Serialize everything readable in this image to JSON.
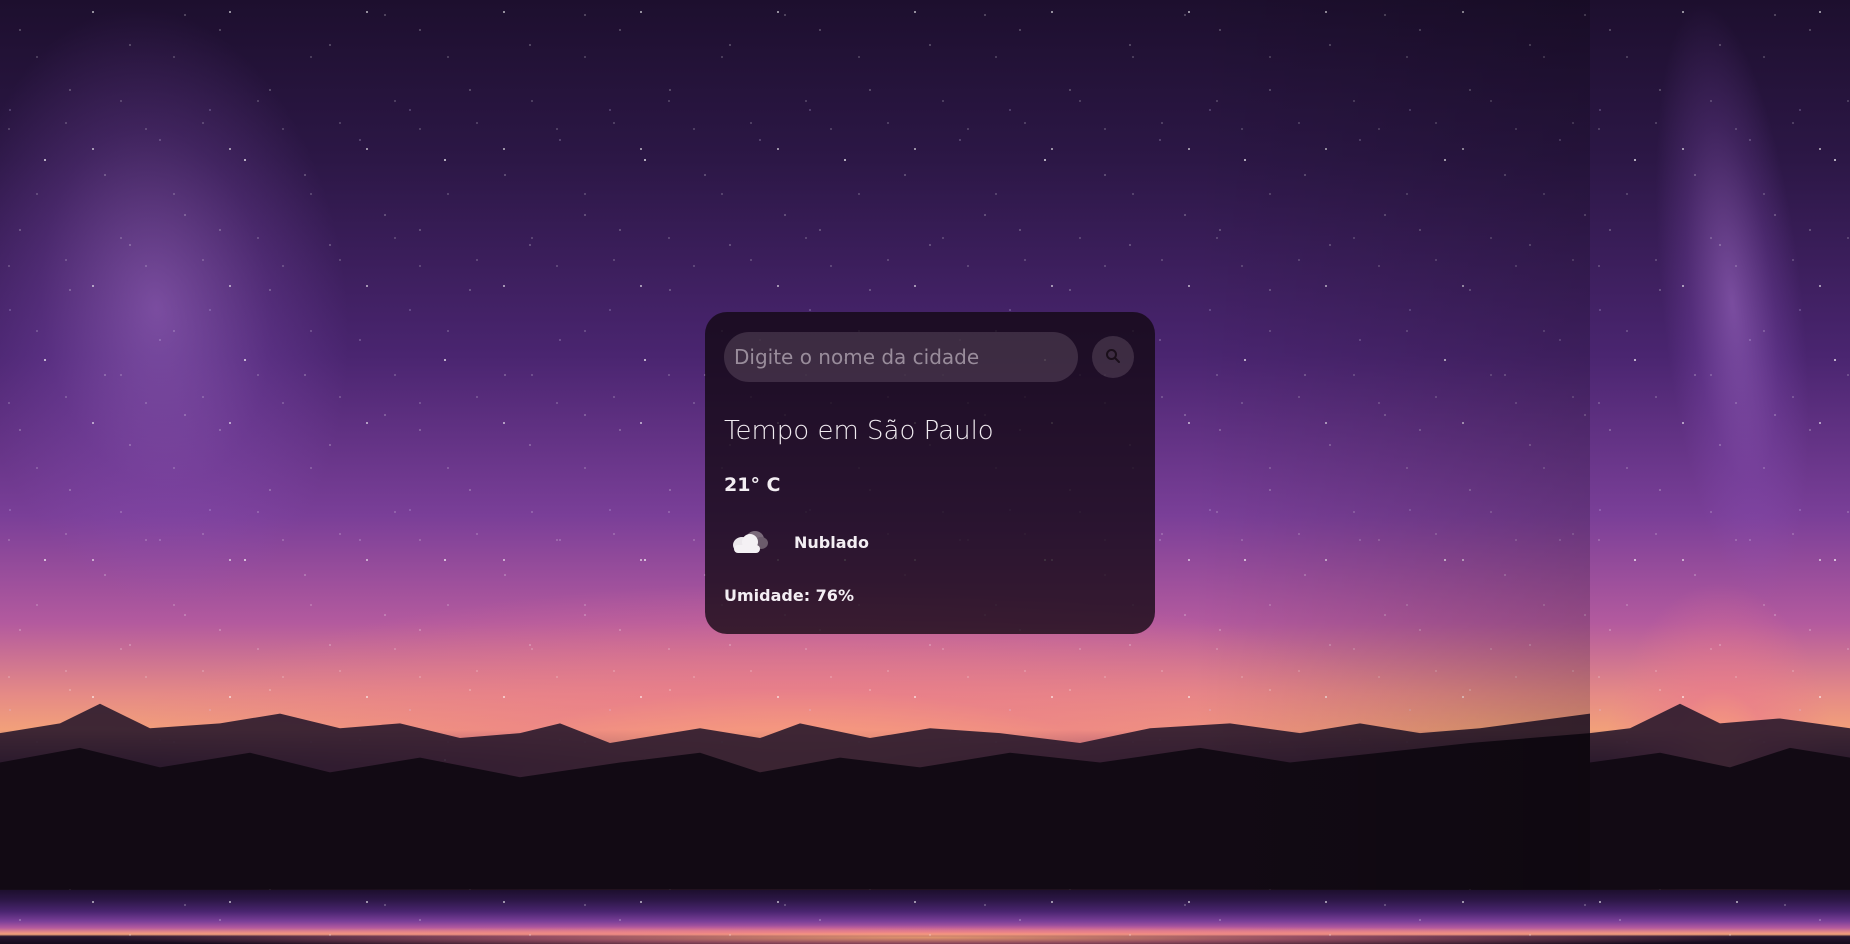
{
  "search": {
    "placeholder": "Digite o nome da cidade",
    "button_icon": "search-icon"
  },
  "weather": {
    "title": "Tempo em São Paulo",
    "temperature": "21° C",
    "condition_icon": "cloud-icon",
    "description": "Nublado",
    "humidity": "Umidade: 76%"
  },
  "colors": {
    "card_background": "#120812",
    "text": "#f3eef3",
    "input_background": "#786478"
  }
}
